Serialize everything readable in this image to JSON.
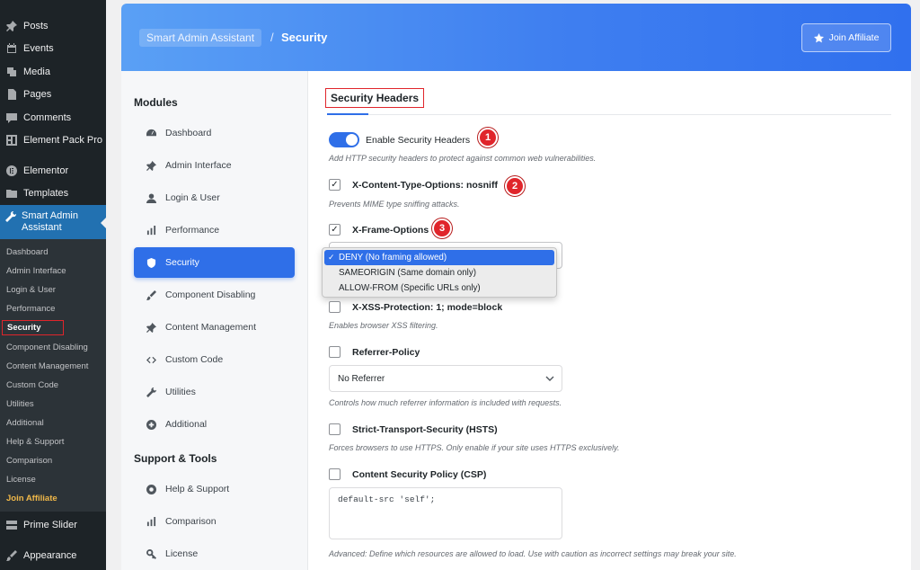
{
  "wp_menu": [
    {
      "label": "Posts",
      "icon": "pin-icon"
    },
    {
      "label": "Events",
      "icon": "calendar-icon"
    },
    {
      "label": "Media",
      "icon": "media-icon"
    },
    {
      "label": "Pages",
      "icon": "page-icon"
    },
    {
      "label": "Comments",
      "icon": "comment-icon"
    },
    {
      "label": "Element Pack Pro",
      "icon": "grid-icon"
    },
    {
      "label": "Elementor",
      "icon": "elementor-icon"
    },
    {
      "label": "Templates",
      "icon": "folder-icon"
    },
    {
      "label": "Smart Admin Assistant",
      "icon": "wrench-icon"
    },
    {
      "label": "Prime Slider",
      "icon": "slider-icon"
    },
    {
      "label": "Appearance",
      "icon": "brush-icon"
    }
  ],
  "wp_submenu": [
    "Dashboard",
    "Admin Interface",
    "Login & User",
    "Performance",
    "Security",
    "Component Disabling",
    "Content Management",
    "Custom Code",
    "Utilities",
    "Additional",
    "Help & Support",
    "Comparison",
    "License",
    "Join Affiliate"
  ],
  "header": {
    "breadcrumb_root": "Smart Admin Assistant",
    "breadcrumb_sep": "/",
    "breadcrumb_current": "Security",
    "affiliate_label": "Join Affiliate"
  },
  "modules": {
    "title": "Modules",
    "items": [
      "Dashboard",
      "Admin Interface",
      "Login & User",
      "Performance",
      "Security",
      "Component Disabling",
      "Content Management",
      "Custom Code",
      "Utilities",
      "Additional"
    ],
    "support_title": "Support & Tools",
    "support_items": [
      "Help & Support",
      "Comparison",
      "License"
    ]
  },
  "panel": {
    "title": "Security Headers",
    "enable_label": "Enable Security Headers",
    "enable_desc": "Add HTTP security headers to protect against common web vulnerabilities.",
    "xcto_label": "X-Content-Type-Options: nosniff",
    "xcto_desc": "Prevents MIME type sniffing attacks.",
    "xfo_label": "X-Frame-Options",
    "xfo_options": [
      "DENY (No framing allowed)",
      "SAMEORIGIN (Same domain only)",
      "ALLOW-FROM (Specific URLs only)"
    ],
    "xss_label": "X-XSS-Protection: 1; mode=block",
    "xss_desc": "Enables browser XSS filtering.",
    "referrer_label": "Referrer-Policy",
    "referrer_value": "No Referrer",
    "referrer_desc": "Controls how much referrer information is included with requests.",
    "hsts_label": "Strict-Transport-Security (HSTS)",
    "hsts_desc": "Forces browsers to use HTTPS. Only enable if your site uses HTTPS exclusively.",
    "csp_label": "Content Security Policy (CSP)",
    "csp_value": "default-src 'self';",
    "csp_desc": "Advanced: Define which resources are allowed to load. Use with caution as incorrect settings may break your site.",
    "check_glyph": "✓"
  },
  "badges": [
    "1",
    "2",
    "3"
  ],
  "colors": {
    "accent": "#2f6fe8",
    "annotation": "#e0252b",
    "affiliate": "#f0b849"
  }
}
